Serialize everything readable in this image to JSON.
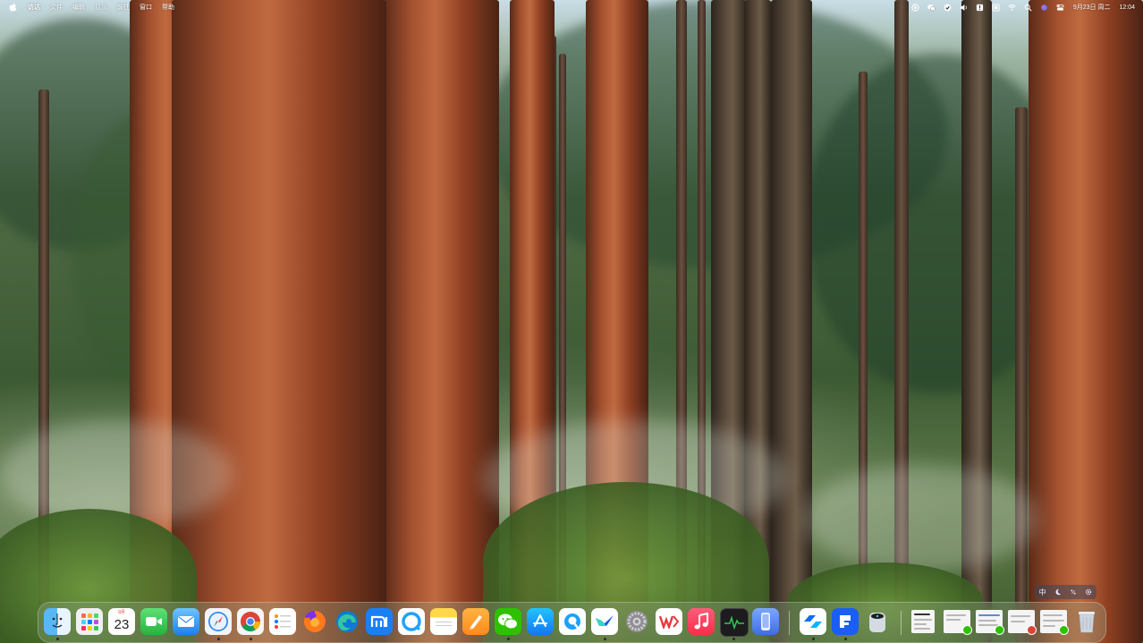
{
  "menubar": {
    "apple_icon": "apple-logo-icon",
    "app_name": "访达",
    "menus": [
      "文件",
      "编辑",
      "显示",
      "前往",
      "窗口",
      "帮助"
    ],
    "status_icons": [
      "screen-record-icon",
      "wechat-icon",
      "green-app-icon",
      "sound-icon",
      "info-icon",
      "scan-icon",
      "wifi-icon",
      "search-icon",
      "siri-icon",
      "control-center-icon"
    ],
    "date": "9月23日 周二",
    "time": "12:04"
  },
  "ime_bar": {
    "mode": "中",
    "icons": [
      "moon-icon",
      "punctuation-icon",
      "settings-gear-icon"
    ]
  },
  "dock": {
    "calendar_day": "23",
    "calendar_month": "9月",
    "apps": [
      {
        "name": "Finder",
        "icon": "finder-icon",
        "running": true
      },
      {
        "name": "Launchpad",
        "icon": "launchpad-icon",
        "running": false
      },
      {
        "name": "Calendar",
        "icon": "calendar-icon",
        "running": false
      },
      {
        "name": "FaceTime",
        "icon": "facetime-icon",
        "running": false
      },
      {
        "name": "Mail",
        "icon": "mail-icon",
        "running": false
      },
      {
        "name": "Safari",
        "icon": "safari-icon",
        "running": true
      },
      {
        "name": "Chrome",
        "icon": "chrome-icon",
        "running": true
      },
      {
        "name": "Reminders",
        "icon": "reminders-icon",
        "running": false
      },
      {
        "name": "Firefox",
        "icon": "firefox-icon",
        "running": false
      },
      {
        "name": "Edge",
        "icon": "edge-icon",
        "running": false
      },
      {
        "name": "Mi Home",
        "icon": "mi-icon",
        "running": false
      },
      {
        "name": "QQ Browser",
        "icon": "qq-browser-icon",
        "running": false
      },
      {
        "name": "Notes",
        "icon": "notes-icon",
        "running": false
      },
      {
        "name": "Pages",
        "icon": "pages-icon",
        "running": false
      },
      {
        "name": "WeChat",
        "icon": "wechat-icon",
        "running": true
      },
      {
        "name": "App Store",
        "icon": "app-store-icon",
        "running": false
      },
      {
        "name": "QQ",
        "icon": "qq-icon",
        "running": false
      },
      {
        "name": "Lark",
        "icon": "lark-icon",
        "running": true
      },
      {
        "name": "System Settings",
        "icon": "system-settings-icon",
        "running": false
      },
      {
        "name": "WPS Office",
        "icon": "wps-icon",
        "running": false
      },
      {
        "name": "Music",
        "icon": "music-icon",
        "running": false
      },
      {
        "name": "Activity Monitor",
        "icon": "activity-monitor-icon",
        "running": true
      },
      {
        "name": "iPhone Mirroring",
        "icon": "iphone-mirroring-icon",
        "running": false
      },
      {
        "name": "Tencent Meeting",
        "icon": "tencent-meeting-icon",
        "running": true
      },
      {
        "name": "Feishu Docs",
        "icon": "feishu-docs-icon",
        "running": true
      },
      {
        "name": "Disk Utility",
        "icon": "disk-utility-icon",
        "running": false
      },
      {
        "name": "Trash",
        "icon": "trash-icon",
        "running": false
      }
    ]
  },
  "colors": {
    "menubar_text": "#ffffff",
    "dock_bg": "rgba(140,160,130,0.35)",
    "wechat_green": "#2dc100"
  }
}
